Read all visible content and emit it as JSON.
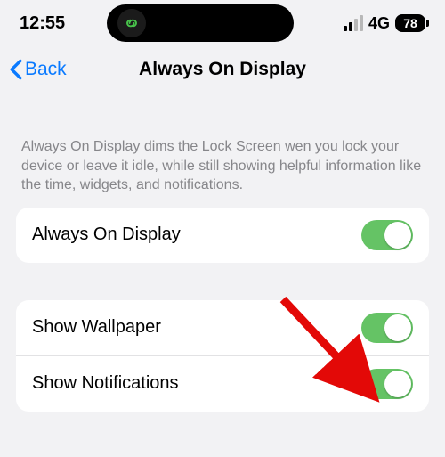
{
  "status": {
    "time": "12:55",
    "network": "4G",
    "battery": "78"
  },
  "nav": {
    "back": "Back",
    "title": "Always On Display"
  },
  "description": "Always On Display dims the Lock Screen wen you lock your device or leave it idle, while still showing helpful information like the time, widgets, and notifications.",
  "rows": {
    "aod": "Always On Display",
    "wallpaper": "Show Wallpaper",
    "notifications": "Show Notifications"
  }
}
